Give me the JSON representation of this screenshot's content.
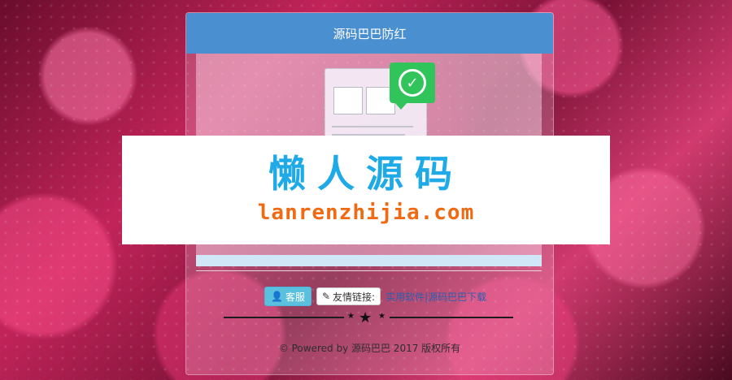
{
  "header": {
    "title": "源码巴巴防红"
  },
  "actions": {
    "kefu_label": "客服",
    "friend_links_label": "友情链接:",
    "link_label": "实用软件|源码巴巴下载"
  },
  "footer": {
    "text": "© Powered by 源码巴巴 2017 版权所有"
  },
  "watermark": {
    "title": "懒人源码",
    "url": "lanrenzhijia.com"
  },
  "icons": {
    "check": "check-circle-icon",
    "user": "user-icon",
    "pencil": "pencil-icon",
    "star": "star-icon"
  },
  "colors": {
    "header": "#4a8fd0",
    "check": "#31c45a",
    "kefu_button": "#5bc0de",
    "watermark_title": "#1eaae7",
    "watermark_url": "#f06a14"
  }
}
